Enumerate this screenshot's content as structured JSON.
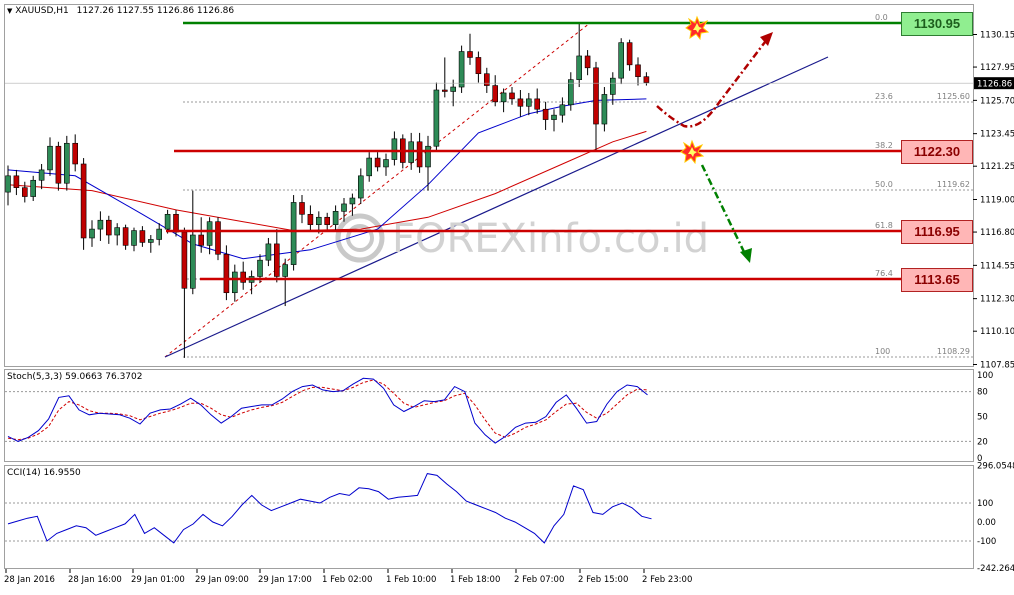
{
  "header": {
    "symbol_timeframe": "XAUUSD,H1",
    "ohlc": [
      "1127.26",
      "1127.55",
      "1126.86",
      "1126.86"
    ]
  },
  "price_axis_ticks": [
    "1130.15",
    "1127.95",
    "1125.70",
    "1123.45",
    "1121.25",
    "1119.00",
    "1116.80",
    "1114.55",
    "1112.30",
    "1110.10",
    "1107.85"
  ],
  "current_price": "1126.86",
  "time_axis_labels": [
    "28 Jan 2016",
    "28 Jan 16:00",
    "29 Jan 01:00",
    "29 Jan 09:00",
    "29 Jan 17:00",
    "1 Feb 02:00",
    "1 Feb 10:00",
    "1 Feb 18:00",
    "2 Feb 07:00",
    "2 Feb 15:00",
    "2 Feb 23:00"
  ],
  "fibonacci": {
    "levels": [
      {
        "ratio": "0.0",
        "price_label": ""
      },
      {
        "ratio": "23.6",
        "price_label": "1125.60"
      },
      {
        "ratio": "38.2",
        "price_label": ""
      },
      {
        "ratio": "50.0",
        "price_label": "1119.62"
      },
      {
        "ratio": "61.8",
        "price_label": ""
      },
      {
        "ratio": "76.4",
        "price_label": ""
      },
      {
        "ratio": "100",
        "price_label": "1108.29"
      }
    ]
  },
  "level_boxes": [
    {
      "label": "1130.95",
      "price": 1130.95,
      "color": "#90ee90",
      "line_color": "#008000"
    },
    {
      "label": "1122.30",
      "price": 1122.3,
      "color": "#ffb6b6",
      "line_color": "#cc0000"
    },
    {
      "label": "1116.95",
      "price": 1116.95,
      "color": "#ffb6b6",
      "line_color": "#cc0000"
    },
    {
      "label": "1113.65",
      "price": 1113.65,
      "color": "#ffb6b6",
      "line_color": "#cc0000"
    }
  ],
  "watermark": "FOREXinfo.co.id",
  "stoch": {
    "label": "Stoch(5,3,3) 59.0663 76.3702",
    "ticks": [
      "100",
      "80",
      "50",
      "20",
      "0"
    ],
    "main": [
      26,
      20,
      25,
      33,
      47,
      73,
      75,
      58,
      52,
      54,
      53,
      52,
      48,
      41,
      54,
      58,
      59,
      65,
      72,
      64,
      52,
      42,
      50,
      60,
      62,
      64,
      64,
      71,
      80,
      86,
      88,
      82,
      80,
      81,
      89,
      96,
      95,
      84,
      64,
      56,
      62,
      69,
      68,
      70,
      86,
      80,
      42,
      28,
      18,
      26,
      37,
      42,
      43,
      50,
      67,
      76,
      60,
      42,
      44,
      65,
      80,
      88,
      86,
      76
    ],
    "signal": [
      24,
      22,
      24,
      29,
      38,
      58,
      68,
      64,
      57,
      54,
      54,
      53,
      51,
      46,
      50,
      54,
      57,
      61,
      66,
      66,
      60,
      52,
      49,
      54,
      58,
      61,
      63,
      67,
      74,
      81,
      85,
      85,
      83,
      81,
      85,
      91,
      94,
      89,
      78,
      66,
      61,
      64,
      67,
      69,
      75,
      78,
      64,
      46,
      30,
      25,
      30,
      37,
      41,
      46,
      56,
      65,
      66,
      55,
      48,
      54,
      65,
      76,
      83,
      82
    ]
  },
  "cci": {
    "label": "CCI(14) 16.9550",
    "ticks": [
      "296.0548",
      "100",
      "0.00",
      "-100",
      "-242.2641"
    ],
    "values": [
      -10,
      5,
      20,
      30,
      -100,
      -60,
      -40,
      -20,
      -30,
      -70,
      -50,
      -30,
      -10,
      40,
      -60,
      -30,
      -70,
      -110,
      -40,
      -10,
      40,
      0,
      -20,
      30,
      90,
      140,
      90,
      60,
      80,
      100,
      120,
      110,
      100,
      130,
      150,
      140,
      180,
      175,
      160,
      120,
      130,
      135,
      140,
      255,
      245,
      200,
      160,
      110,
      90,
      70,
      50,
      20,
      0,
      -30,
      -60,
      -110,
      -20,
      40,
      190,
      170,
      50,
      40,
      80,
      100,
      75,
      30,
      17
    ]
  },
  "chart_data": {
    "type": "candlestick",
    "symbol": "XAUUSD",
    "timeframe": "H1",
    "ylim": [
      1106.8,
      1132.4
    ],
    "candles": [
      [
        1119.5,
        1121.3,
        1118.6,
        1120.6
      ],
      [
        1120.6,
        1121.0,
        1119.3,
        1119.8
      ],
      [
        1119.8,
        1120.2,
        1118.8,
        1119.2
      ],
      [
        1119.2,
        1120.6,
        1118.9,
        1120.3
      ],
      [
        1120.3,
        1121.4,
        1119.7,
        1121.0
      ],
      [
        1121.0,
        1123.2,
        1120.6,
        1122.6
      ],
      [
        1122.6,
        1122.9,
        1119.6,
        1120.1
      ],
      [
        1120.1,
        1123.3,
        1119.6,
        1122.8
      ],
      [
        1122.8,
        1123.4,
        1120.9,
        1121.4
      ],
      [
        1121.4,
        1121.8,
        1115.6,
        1116.4
      ],
      [
        1116.4,
        1117.6,
        1115.8,
        1117.0
      ],
      [
        1117.0,
        1118.2,
        1116.2,
        1117.6
      ],
      [
        1117.6,
        1117.9,
        1116.0,
        1116.6
      ],
      [
        1116.6,
        1117.4,
        1115.9,
        1117.1
      ],
      [
        1117.1,
        1117.3,
        1115.6,
        1115.9
      ],
      [
        1115.9,
        1117.1,
        1115.5,
        1116.9
      ],
      [
        1116.9,
        1117.2,
        1115.8,
        1116.1
      ],
      [
        1116.1,
        1116.6,
        1115.4,
        1116.3
      ],
      [
        1116.3,
        1117.4,
        1115.9,
        1117.0
      ],
      [
        1117.0,
        1118.3,
        1116.7,
        1118.0
      ],
      [
        1118.0,
        1118.3,
        1116.5,
        1116.8
      ],
      [
        1116.8,
        1117.1,
        1108.3,
        1113.0
      ],
      [
        1113.0,
        1119.6,
        1112.6,
        1116.6
      ],
      [
        1116.6,
        1117.8,
        1115.4,
        1115.9
      ],
      [
        1115.9,
        1117.8,
        1115.3,
        1117.5
      ],
      [
        1117.5,
        1117.8,
        1114.9,
        1115.3
      ],
      [
        1115.3,
        1115.9,
        1112.2,
        1112.7
      ],
      [
        1112.7,
        1114.6,
        1112.1,
        1114.1
      ],
      [
        1114.1,
        1114.8,
        1112.9,
        1113.4
      ],
      [
        1113.4,
        1114.2,
        1112.6,
        1113.8
      ],
      [
        1113.8,
        1115.3,
        1113.4,
        1114.9
      ],
      [
        1114.9,
        1116.4,
        1114.5,
        1116.0
      ],
      [
        1116.0,
        1117.0,
        1113.4,
        1113.8
      ],
      [
        1113.8,
        1115.0,
        1111.8,
        1114.6
      ],
      [
        1114.6,
        1119.3,
        1114.2,
        1118.8
      ],
      [
        1118.8,
        1119.3,
        1117.4,
        1118.0
      ],
      [
        1118.0,
        1118.6,
        1116.9,
        1117.3
      ],
      [
        1117.3,
        1118.2,
        1116.7,
        1117.8
      ],
      [
        1117.8,
        1118.1,
        1117.0,
        1117.3
      ],
      [
        1117.3,
        1118.6,
        1116.9,
        1118.2
      ],
      [
        1118.2,
        1119.1,
        1117.5,
        1118.7
      ],
      [
        1118.7,
        1119.4,
        1117.9,
        1119.1
      ],
      [
        1119.1,
        1121.1,
        1118.7,
        1120.6
      ],
      [
        1120.6,
        1122.2,
        1120.2,
        1121.8
      ],
      [
        1121.8,
        1122.2,
        1120.9,
        1121.2
      ],
      [
        1121.2,
        1122.1,
        1120.6,
        1121.7
      ],
      [
        1121.7,
        1123.6,
        1121.3,
        1123.1
      ],
      [
        1123.1,
        1123.4,
        1121.1,
        1121.5
      ],
      [
        1121.5,
        1123.5,
        1121.0,
        1122.9
      ],
      [
        1122.9,
        1123.5,
        1120.8,
        1121.2
      ],
      [
        1121.2,
        1123.3,
        1119.6,
        1122.6
      ],
      [
        1122.6,
        1126.9,
        1122.3,
        1126.4
      ],
      [
        1126.4,
        1128.6,
        1125.9,
        1126.3
      ],
      [
        1126.3,
        1127.1,
        1125.3,
        1126.6
      ],
      [
        1126.6,
        1129.4,
        1126.2,
        1129.0
      ],
      [
        1129.0,
        1130.2,
        1128.1,
        1128.6
      ],
      [
        1128.6,
        1129.0,
        1126.9,
        1127.5
      ],
      [
        1127.5,
        1127.9,
        1126.2,
        1126.7
      ],
      [
        1126.7,
        1127.4,
        1125.3,
        1125.6
      ],
      [
        1125.6,
        1126.5,
        1124.9,
        1126.2
      ],
      [
        1126.2,
        1126.6,
        1125.4,
        1125.8
      ],
      [
        1125.8,
        1126.4,
        1124.6,
        1125.3
      ],
      [
        1125.3,
        1126.2,
        1124.7,
        1125.8
      ],
      [
        1125.8,
        1126.5,
        1124.8,
        1125.1
      ],
      [
        1125.1,
        1125.6,
        1123.7,
        1124.4
      ],
      [
        1124.4,
        1125.1,
        1123.6,
        1124.7
      ],
      [
        1124.7,
        1125.9,
        1124.2,
        1125.4
      ],
      [
        1125.4,
        1127.6,
        1125.0,
        1127.1
      ],
      [
        1127.1,
        1130.9,
        1126.6,
        1128.7
      ],
      [
        1128.7,
        1129.1,
        1127.4,
        1127.9
      ],
      [
        1127.9,
        1128.3,
        1122.3,
        1124.1
      ],
      [
        1124.1,
        1126.6,
        1123.6,
        1126.1
      ],
      [
        1126.1,
        1127.6,
        1125.4,
        1127.2
      ],
      [
        1127.2,
        1129.9,
        1126.8,
        1129.6
      ],
      [
        1129.6,
        1129.8,
        1127.7,
        1128.1
      ],
      [
        1128.1,
        1128.6,
        1126.7,
        1127.3
      ],
      [
        1127.3,
        1127.6,
        1126.7,
        1126.9
      ]
    ],
    "ma_blue": [
      [
        0,
        1121.0
      ],
      [
        8,
        1120.6
      ],
      [
        16,
        1118.0
      ],
      [
        22,
        1116.0
      ],
      [
        28,
        1115.0
      ],
      [
        36,
        1115.6
      ],
      [
        44,
        1117.0
      ],
      [
        50,
        1120.0
      ],
      [
        56,
        1123.5
      ],
      [
        62,
        1124.8
      ],
      [
        66,
        1125.3
      ],
      [
        70,
        1125.7
      ],
      [
        76,
        1125.8
      ]
    ],
    "ma_red": [
      [
        0,
        1120.0
      ],
      [
        10,
        1119.6
      ],
      [
        20,
        1118.3
      ],
      [
        28,
        1117.5
      ],
      [
        34,
        1116.9
      ],
      [
        42,
        1117.0
      ],
      [
        50,
        1117.8
      ],
      [
        58,
        1119.4
      ],
      [
        66,
        1121.4
      ],
      [
        72,
        1122.9
      ],
      [
        76,
        1123.6
      ]
    ]
  }
}
